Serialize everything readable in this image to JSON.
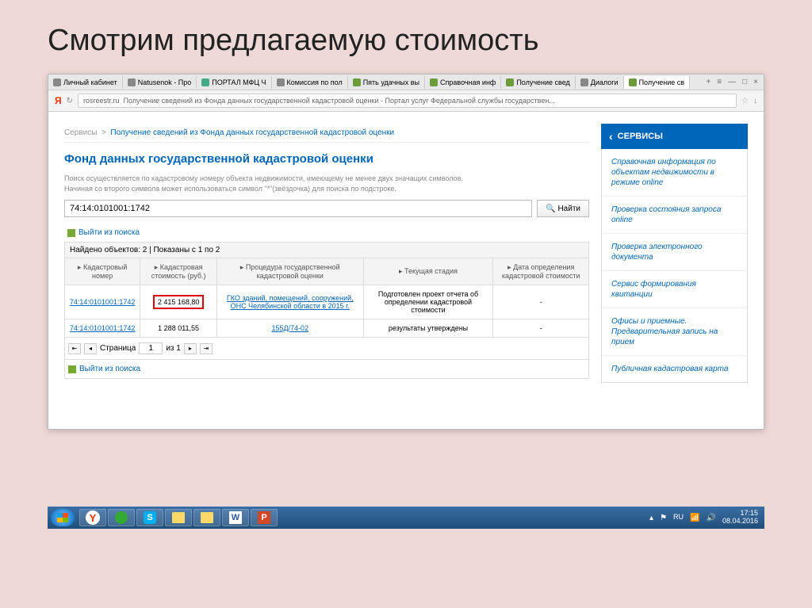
{
  "slide": {
    "title": "Смотрим предлагаемую стоимость"
  },
  "tabs": [
    {
      "label": "Личный кабинет"
    },
    {
      "label": "Natusenok - Про"
    },
    {
      "label": "ПОРТАЛ МФЦ Ч"
    },
    {
      "label": "Комиссия по пол"
    },
    {
      "label": "Пять удачных вы"
    },
    {
      "label": "Справочная инф"
    },
    {
      "label": "Получение свед"
    },
    {
      "label": "Диалоги"
    },
    {
      "label": "Получение св"
    }
  ],
  "url": {
    "host": "rosreestr.ru",
    "title": "Получение сведений из Фонда данных государственной кадастровой оценки - Портал услуг Федеральной службы государствен..."
  },
  "breadcrumb": {
    "root": "Сервисы",
    "current": "Получение сведений из Фонда данных государственной кадастровой оценки"
  },
  "content": {
    "h1": "Фонд данных государственной кадастровой оценки",
    "hint1": "Поиск осуществляется по кадастровому номеру объекта недвижимости, имеющему не менее двух значащих символов.",
    "hint2": "Начиная со второго символа может использоваться символ \"*\"(звёздочка) для поиска по подстроке.",
    "search_value": "74:14:0101001:1742",
    "search_btn": "Найти",
    "exit_label": "Выйти из поиска",
    "found_label": "Найдено объектов: 2 | Показаны с 1 по 2",
    "headers": {
      "c1": "▸ Кадастровый номер",
      "c2": "▸ Кадастровая стоимость (руб.)",
      "c3": "▸ Процедура государственной кадастровой оценки",
      "c4": "▸ Текущая стадия",
      "c5": "▸ Дата определения кадастровой стоимости"
    },
    "rows": [
      {
        "num": "74:14:0101001:1742",
        "cost": "2 415 168,80",
        "highlight": true,
        "proc": "ГКО зданий, помещений, сооружений, ОНС Челябинской области в 2015 г.",
        "stage": "Подготовлен проект отчета об определении кадастровой стоимости",
        "date": "-"
      },
      {
        "num": "74:14:0101001:1742",
        "cost": "1 288 011,55",
        "highlight": false,
        "proc": "155Д/74-02",
        "stage": "результаты утверждены",
        "date": "-"
      }
    ],
    "pager": {
      "page_label": "Страница",
      "page_val": "1",
      "of_label": "из 1"
    }
  },
  "sidebar": {
    "head": "СЕРВИСЫ",
    "links": [
      "Справочная информация по объектам недвижимости в режиме online",
      "Проверка состояния запроса online",
      "Проверка электронного документа",
      "Сервис формирования квитанции",
      "Офисы и приемные. Предварительная запись на прием",
      "Публичная кадастровая карта"
    ]
  },
  "taskbar": {
    "lang": "RU",
    "time": "17:15",
    "date": "08.04.2016"
  }
}
